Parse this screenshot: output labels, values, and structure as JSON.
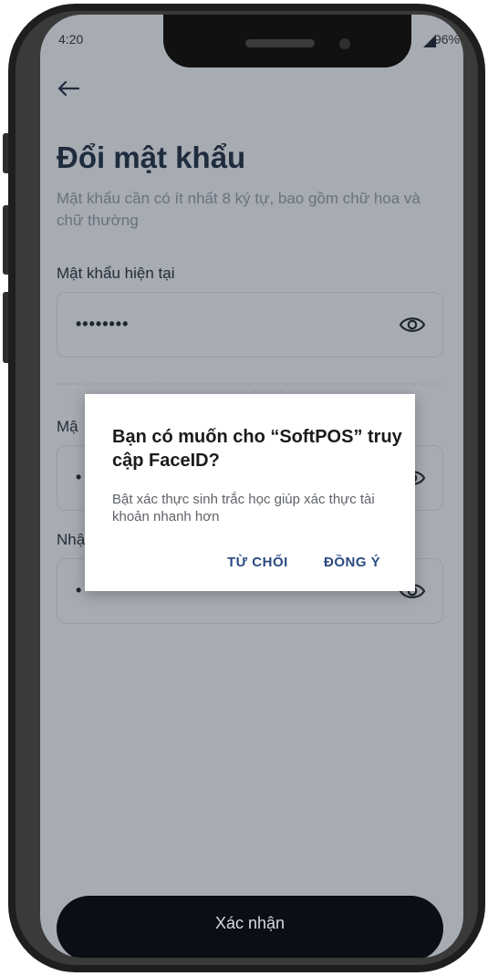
{
  "status_bar": {
    "time": "4:20",
    "battery": "96%"
  },
  "page": {
    "title": "Đổi mật khẩu",
    "description": "Mật khẩu cần có ít nhất 8 ký tự, bao gồm chữ hoa và chữ thường"
  },
  "fields": {
    "current": {
      "label": "Mật khẩu hiện tại",
      "value": "••••••••"
    },
    "new": {
      "label": "Mậ",
      "value": "•"
    },
    "confirm": {
      "label": "Nhậ",
      "value": "•"
    }
  },
  "dialog": {
    "title": "Bạn có muốn cho “SoftPOS” truy cập FaceID?",
    "message": "Bật xác thực sinh trắc học giúp xác thực tài khoản nhanh hơn",
    "deny_label": "TỪ CHỐI",
    "allow_label": "ĐỒNG Ý"
  },
  "submit_label": "Xác nhận",
  "icons": [
    "back-arrow-icon",
    "eye-icon"
  ],
  "colors": {
    "scrim_background": "#a7abb2",
    "dialog_button": "#2b4a82",
    "primary_button": "#0b0f15"
  }
}
